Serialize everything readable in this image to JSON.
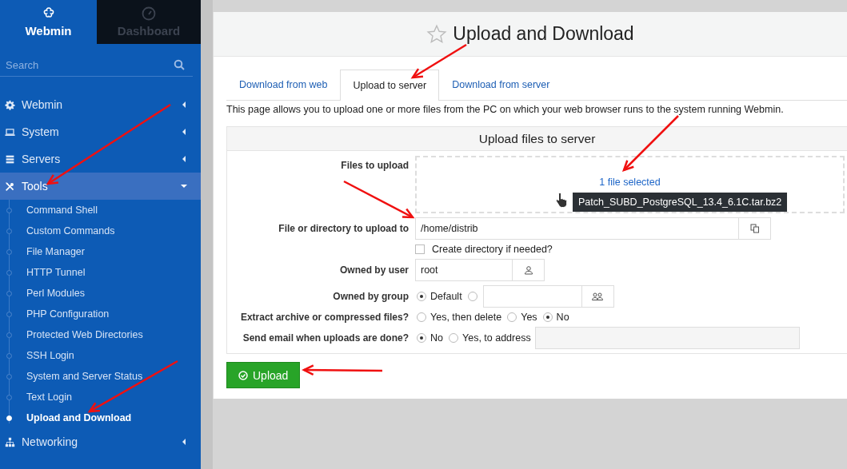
{
  "sidebar": {
    "brand_tabs": [
      {
        "label": "Webmin",
        "selected": true
      },
      {
        "label": "Dashboard",
        "selected": false
      }
    ],
    "search": {
      "placeholder": "Search"
    },
    "menu": [
      {
        "label": "Webmin",
        "expanded": false
      },
      {
        "label": "System",
        "expanded": false
      },
      {
        "label": "Servers",
        "expanded": false
      },
      {
        "label": "Tools",
        "expanded": true,
        "children": [
          {
            "label": "Command Shell",
            "selected": false
          },
          {
            "label": "Custom Commands",
            "selected": false
          },
          {
            "label": "File Manager",
            "selected": false
          },
          {
            "label": "HTTP Tunnel",
            "selected": false
          },
          {
            "label": "Perl Modules",
            "selected": false
          },
          {
            "label": "PHP Configuration",
            "selected": false
          },
          {
            "label": "Protected Web Directories",
            "selected": false
          },
          {
            "label": "SSH Login",
            "selected": false
          },
          {
            "label": "System and Server Status",
            "selected": false
          },
          {
            "label": "Text Login",
            "selected": false
          },
          {
            "label": "Upload and Download",
            "selected": true
          }
        ]
      },
      {
        "label": "Networking",
        "expanded": false
      }
    ]
  },
  "page": {
    "title": "Upload and Download",
    "starred": false,
    "tabs": [
      {
        "label": "Download from web",
        "selected": false
      },
      {
        "label": "Upload to server",
        "selected": true
      },
      {
        "label": "Download from server",
        "selected": false
      }
    ],
    "description": "This page allows you to upload one or more files from the PC on which your web browser runs to the system running Webmin.",
    "form": {
      "title": "Upload files to server",
      "rows": [
        {
          "kind": "dropzone",
          "label": "Files to upload",
          "status": "1 file selected",
          "tooltip": "Patch_SUBD_PostgreSQL_13.4_6.1C.tar.bz2"
        },
        {
          "kind": "path",
          "label": "File or directory to upload to",
          "value": "/home/distrib",
          "checkbox": {
            "label": "Create directory if needed?",
            "checked": false
          }
        },
        {
          "kind": "user",
          "label": "Owned by user",
          "value": "root"
        },
        {
          "kind": "group",
          "label": "Owned by group",
          "options": [
            {
              "label": "Default",
              "selected": true
            },
            {
              "selected": false
            }
          ]
        },
        {
          "kind": "radios",
          "label": "Extract archive or compressed files?",
          "options": [
            {
              "label": "Yes, then delete",
              "selected": false
            },
            {
              "label": "Yes",
              "selected": false
            },
            {
              "label": "No",
              "selected": true
            }
          ]
        },
        {
          "kind": "radios-field",
          "label": "Send email when uploads are done?",
          "options": [
            {
              "label": "No",
              "selected": true
            },
            {
              "label": "Yes, to address",
              "selected": false
            }
          ]
        }
      ]
    },
    "button": "Upload"
  }
}
